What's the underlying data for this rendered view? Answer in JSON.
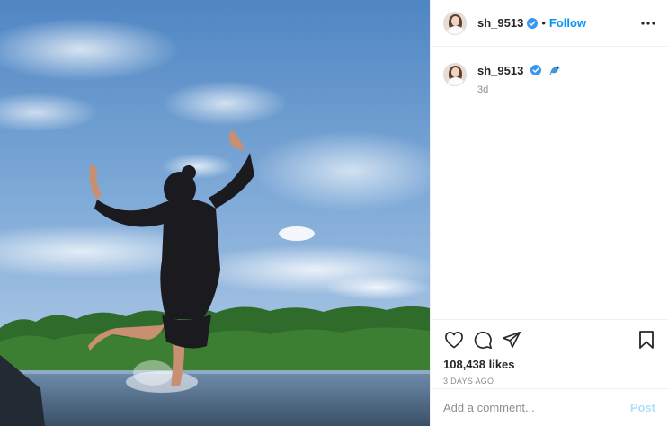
{
  "post": {
    "author": {
      "username": "sh_9513",
      "verified": true,
      "avatar_icon": "profile-avatar"
    },
    "header": {
      "separator": "•",
      "follow_label": "Follow",
      "more_icon": "ellipsis-icon"
    },
    "caption": {
      "username": "sh_9513",
      "emoji_icon": "dolphin-emoji",
      "time_ago": "3d"
    },
    "actions": {
      "like_icon": "heart-icon",
      "comment_icon": "comment-icon",
      "share_icon": "share-icon",
      "save_icon": "bookmark-icon"
    },
    "likes_text": "108,438 likes",
    "date_text": "3 DAYS AGO",
    "comment": {
      "placeholder": "Add a comment...",
      "post_label": "Post"
    },
    "colors": {
      "link_blue": "#0095f6",
      "post_disabled": "#b2dffc",
      "muted_text": "#8e8e8e",
      "border": "#efefef"
    }
  }
}
